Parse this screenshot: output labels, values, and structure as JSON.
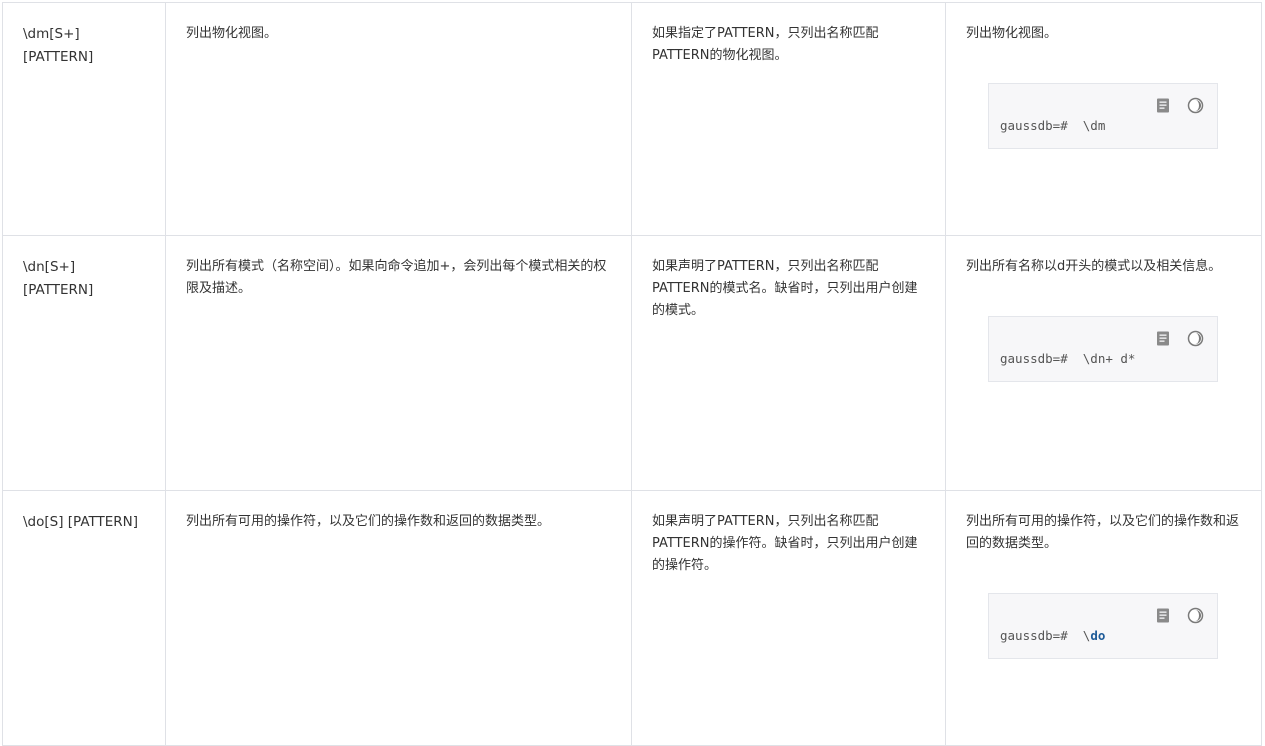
{
  "rows": [
    {
      "command": "\\dm[S+] [PATTERN]",
      "description": "列出物化视图。",
      "pattern_note": "如果指定了PATTERN，只列出名称匹配PATTERN的物化视图。",
      "example_text": "列出物化视图。",
      "code_prompt": "gaussdb=#  \\dm",
      "code_keyword": ""
    },
    {
      "command": "\\dn[S+] [PATTERN]",
      "description": "列出所有模式（名称空间）。如果向命令追加+，会列出每个模式相关的权限及描述。",
      "pattern_note": "如果声明了PATTERN，只列出名称匹配PATTERN的模式名。缺省时，只列出用户创建的模式。",
      "example_text": "列出所有名称以d开头的模式以及相关信息。",
      "code_prompt": "gaussdb=#  \\dn+ d*",
      "code_keyword": ""
    },
    {
      "command": "\\do[S] [PATTERN]",
      "description": "列出所有可用的操作符，以及它们的操作数和返回的数据类型。",
      "pattern_note": "如果声明了PATTERN，只列出名称匹配PATTERN的操作符。缺省时，只列出用户创建的操作符。",
      "example_text": "列出所有可用的操作符，以及它们的操作数和返回的数据类型。",
      "code_prompt": "gaussdb=#  \\",
      "code_keyword": "do"
    }
  ],
  "icons": {
    "copy": "copy-icon",
    "theme": "theme-toggle-icon"
  },
  "colors": {
    "border": "#dfe1e6",
    "code_bg": "#f7f7f9",
    "keyword": "#1f5c99"
  }
}
